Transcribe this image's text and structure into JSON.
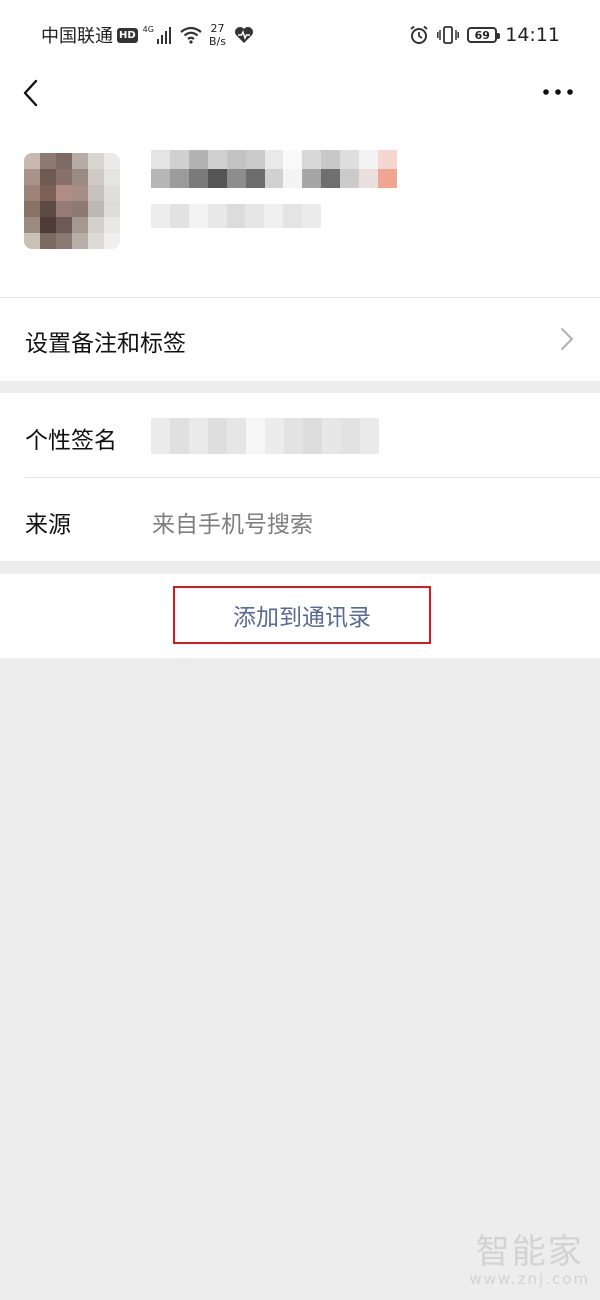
{
  "status_bar": {
    "carrier": "中国联通",
    "hd_badge": "HD",
    "network": "4G",
    "speed_value": "27",
    "speed_unit": "B/s",
    "battery": "69",
    "time": "14:11"
  },
  "profile": {
    "set_remark_label": "设置备注和标签",
    "signature_label": "个性签名",
    "source_label": "来源",
    "source_value": "来自手机号搜索"
  },
  "actions": {
    "add_to_contacts": "添加到通讯录"
  },
  "watermark": {
    "brand": "智能家",
    "url": "www.znj.com"
  },
  "colors": {
    "link_blue": "#576b95",
    "highlight_red": "#d9191d",
    "background_gray": "#ededed"
  },
  "icons": {
    "back": "chevron-left-icon",
    "more": "more-dots-icon",
    "row_arrow": "chevron-right-icon"
  }
}
